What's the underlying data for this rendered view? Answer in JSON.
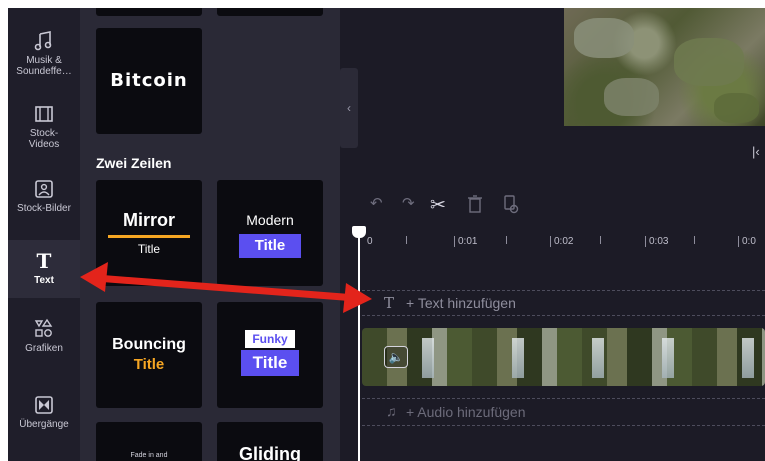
{
  "sidebar": {
    "items": [
      {
        "label": "Musik & Soundeffe…",
        "icon": "music-note-icon"
      },
      {
        "label": "Stock-Videos",
        "icon": "film-icon"
      },
      {
        "label": "Stock-Bilder",
        "icon": "image-icon"
      },
      {
        "label": "Text",
        "icon": "text-t-icon",
        "active": true
      },
      {
        "label": "Grafiken",
        "icon": "shapes-icon"
      },
      {
        "label": "Übergänge",
        "icon": "transition-icon"
      }
    ]
  },
  "panel": {
    "top_tile_text": "Bitcoin",
    "section_title": "Zwei Zeilen",
    "tiles": [
      {
        "line1": "Mirror",
        "line2": "Title"
      },
      {
        "line1": "Modern",
        "line2": "Title"
      },
      {
        "line1": "Bouncing",
        "line2": "Title"
      },
      {
        "line1": "Funky",
        "line2": "Title"
      },
      {
        "line1": "Fade in and",
        "line2": ""
      },
      {
        "line1": "Gliding",
        "line2": ""
      }
    ]
  },
  "timeline": {
    "ruler_labels": [
      "0",
      "0:01",
      "0:02",
      "0:03",
      "0:0"
    ],
    "text_track_label": "+ Text hinzufügen",
    "audio_track_label": "+ Audio hinzufügen"
  },
  "colors": {
    "accent_purple": "#5b4ff0",
    "accent_orange": "#f6a623",
    "annotation_red": "#e3241b"
  }
}
